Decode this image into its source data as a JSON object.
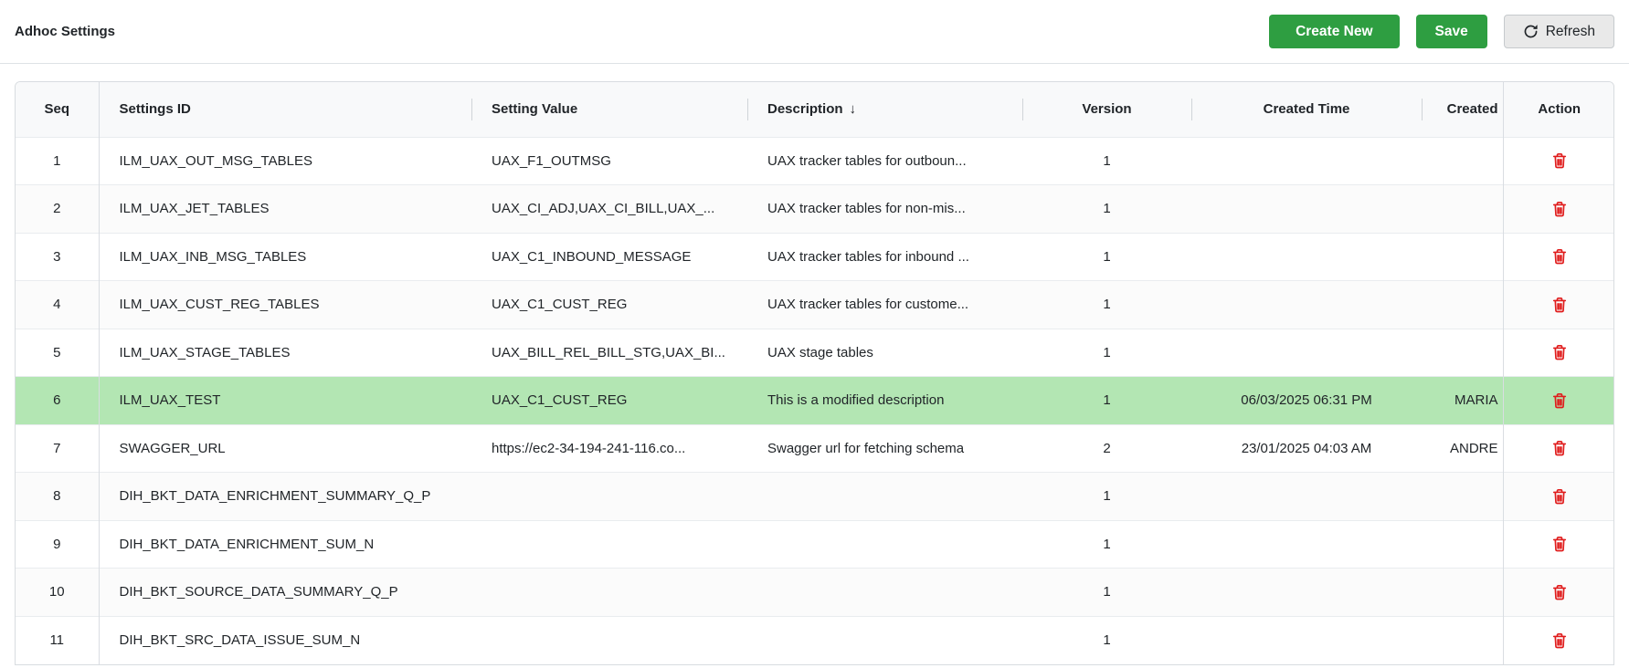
{
  "page": {
    "title": "Adhoc Settings"
  },
  "toolbar": {
    "create_new_label": "Create New",
    "save_label": "Save",
    "refresh_label": "Refresh"
  },
  "icons": {
    "sort_desc": "↓",
    "refresh": "refresh-circular-arrow",
    "trash": "trash-can"
  },
  "colors": {
    "accent_green": "#2e9e41",
    "refresh_bg": "#e9e9e9",
    "refresh_border": "#c6cacd",
    "row_highlight": "#b3e6b3",
    "danger_red": "#e01b1b",
    "header_bg": "#f8f9fa",
    "border_light": "#dee2e6",
    "border_outer": "#d8dce0",
    "row_border": "#e9ecef",
    "fixed_border": "#d9dde2",
    "sep": "#d0d4d8"
  },
  "table": {
    "columns": [
      {
        "key": "seq",
        "label": "Seq"
      },
      {
        "key": "settings_id",
        "label": "Settings ID"
      },
      {
        "key": "setting_value",
        "label": "Setting Value"
      },
      {
        "key": "description",
        "label": "Description",
        "sorted": "desc"
      },
      {
        "key": "version",
        "label": "Version"
      },
      {
        "key": "created_time",
        "label": "Created Time"
      },
      {
        "key": "created",
        "label": "Created"
      },
      {
        "key": "action",
        "label": "Action"
      }
    ],
    "rows": [
      {
        "seq": "1",
        "settings_id": "ILM_UAX_OUT_MSG_TABLES",
        "setting_value": "UAX_F1_OUTMSG",
        "description": "UAX tracker tables for outboun...",
        "version": "1",
        "created_time": "",
        "created": "",
        "highlighted": false
      },
      {
        "seq": "2",
        "settings_id": "ILM_UAX_JET_TABLES",
        "setting_value": "UAX_CI_ADJ,UAX_CI_BILL,UAX_...",
        "description": "UAX tracker tables for non-mis...",
        "version": "1",
        "created_time": "",
        "created": "",
        "highlighted": false
      },
      {
        "seq": "3",
        "settings_id": "ILM_UAX_INB_MSG_TABLES",
        "setting_value": "UAX_C1_INBOUND_MESSAGE",
        "description": "UAX tracker tables for inbound ...",
        "version": "1",
        "created_time": "",
        "created": "",
        "highlighted": false
      },
      {
        "seq": "4",
        "settings_id": "ILM_UAX_CUST_REG_TABLES",
        "setting_value": "UAX_C1_CUST_REG",
        "description": "UAX tracker tables for custome...",
        "version": "1",
        "created_time": "",
        "created": "",
        "highlighted": false
      },
      {
        "seq": "5",
        "settings_id": "ILM_UAX_STAGE_TABLES",
        "setting_value": "UAX_BILL_REL_BILL_STG,UAX_BI...",
        "description": "UAX stage tables",
        "version": "1",
        "created_time": "",
        "created": "",
        "highlighted": false
      },
      {
        "seq": "6",
        "settings_id": "ILM_UAX_TEST",
        "setting_value": "UAX_C1_CUST_REG",
        "description": "This is a modified description",
        "version": "1",
        "created_time": "06/03/2025 06:31 PM",
        "created": "MARIA",
        "highlighted": true
      },
      {
        "seq": "7",
        "settings_id": "SWAGGER_URL",
        "setting_value": "https://ec2-34-194-241-116.co...",
        "description": "Swagger url for fetching schema",
        "version": "2",
        "created_time": "23/01/2025 04:03 AM",
        "created": "ANDRE",
        "highlighted": false
      },
      {
        "seq": "8",
        "settings_id": "DIH_BKT_DATA_ENRICHMENT_SUMMARY_Q_P",
        "setting_value": "",
        "description": "",
        "version": "1",
        "created_time": "",
        "created": "",
        "highlighted": false
      },
      {
        "seq": "9",
        "settings_id": "DIH_BKT_DATA_ENRICHMENT_SUM_N",
        "setting_value": "",
        "description": "",
        "version": "1",
        "created_time": "",
        "created": "",
        "highlighted": false
      },
      {
        "seq": "10",
        "settings_id": "DIH_BKT_SOURCE_DATA_SUMMARY_Q_P",
        "setting_value": "",
        "description": "",
        "version": "1",
        "created_time": "",
        "created": "",
        "highlighted": false
      },
      {
        "seq": "11",
        "settings_id": "DIH_BKT_SRC_DATA_ISSUE_SUM_N",
        "setting_value": "",
        "description": "",
        "version": "1",
        "created_time": "",
        "created": "",
        "highlighted": false
      }
    ]
  }
}
